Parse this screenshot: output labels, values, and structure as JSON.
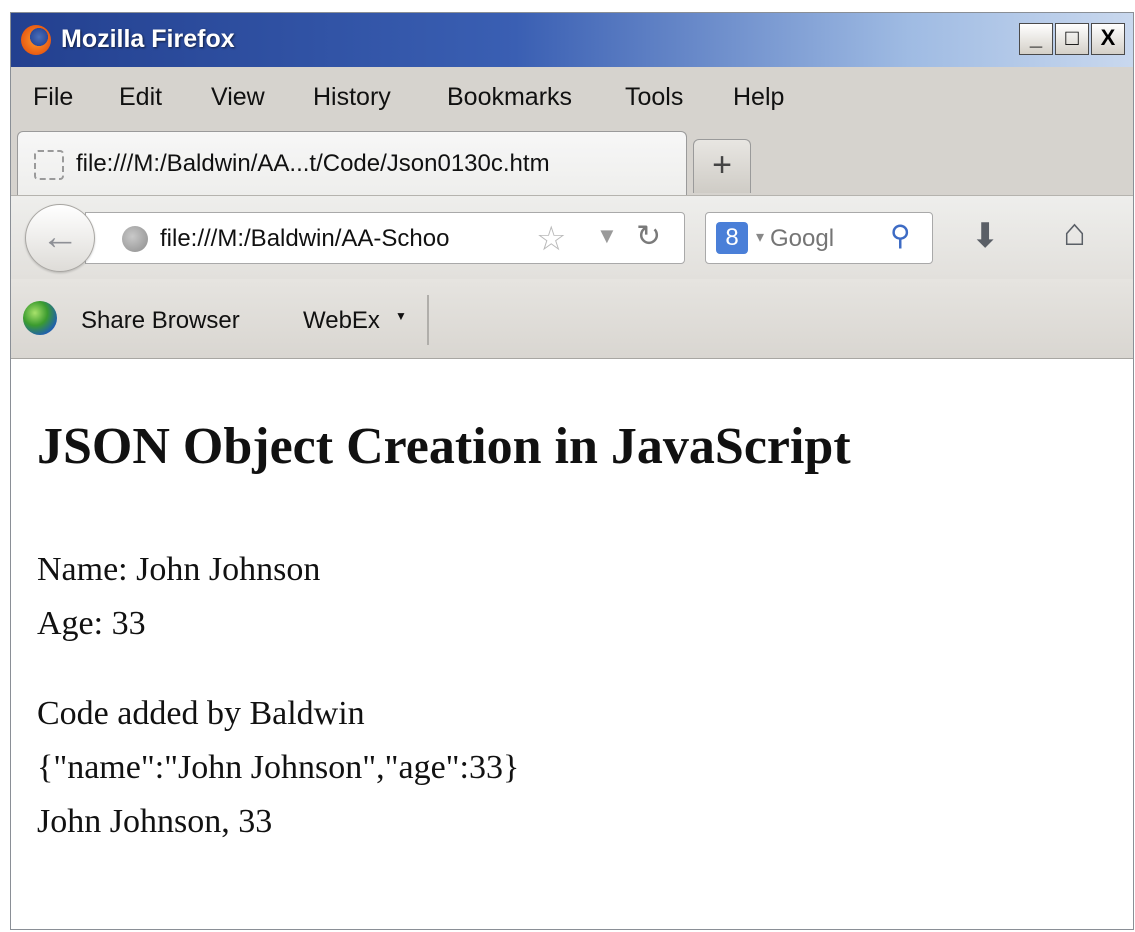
{
  "window": {
    "title": "Mozilla Firefox",
    "buttons": {
      "minimize": "_",
      "maximize": "□",
      "close": "X"
    }
  },
  "menu": [
    "File",
    "Edit",
    "View",
    "History",
    "Bookmarks",
    "Tools",
    "Help"
  ],
  "tab": {
    "title": "file:///M:/Baldwin/AA...t/Code/Json0130c.htm",
    "new_tab": "+"
  },
  "nav": {
    "url": "file:///M:/Baldwin/AA-Schoo",
    "search_placeholder": "Googl",
    "search_engine_icon": "8"
  },
  "bookmarks_bar": {
    "share": "Share Browser",
    "webex": "WebEx"
  },
  "page": {
    "heading": "JSON Object Creation in JavaScript",
    "name_line": "Name: John Johnson",
    "age_line": "Age: 33",
    "code_line": "Code added by Baldwin",
    "json_line": "{\"name\":\"John Johnson\",\"age\":33}",
    "result_line": "John Johnson, 33"
  },
  "colors": {
    "titlebar": "#23408f",
    "chrome": "#d6d3ce",
    "content": "#ffffff"
  }
}
